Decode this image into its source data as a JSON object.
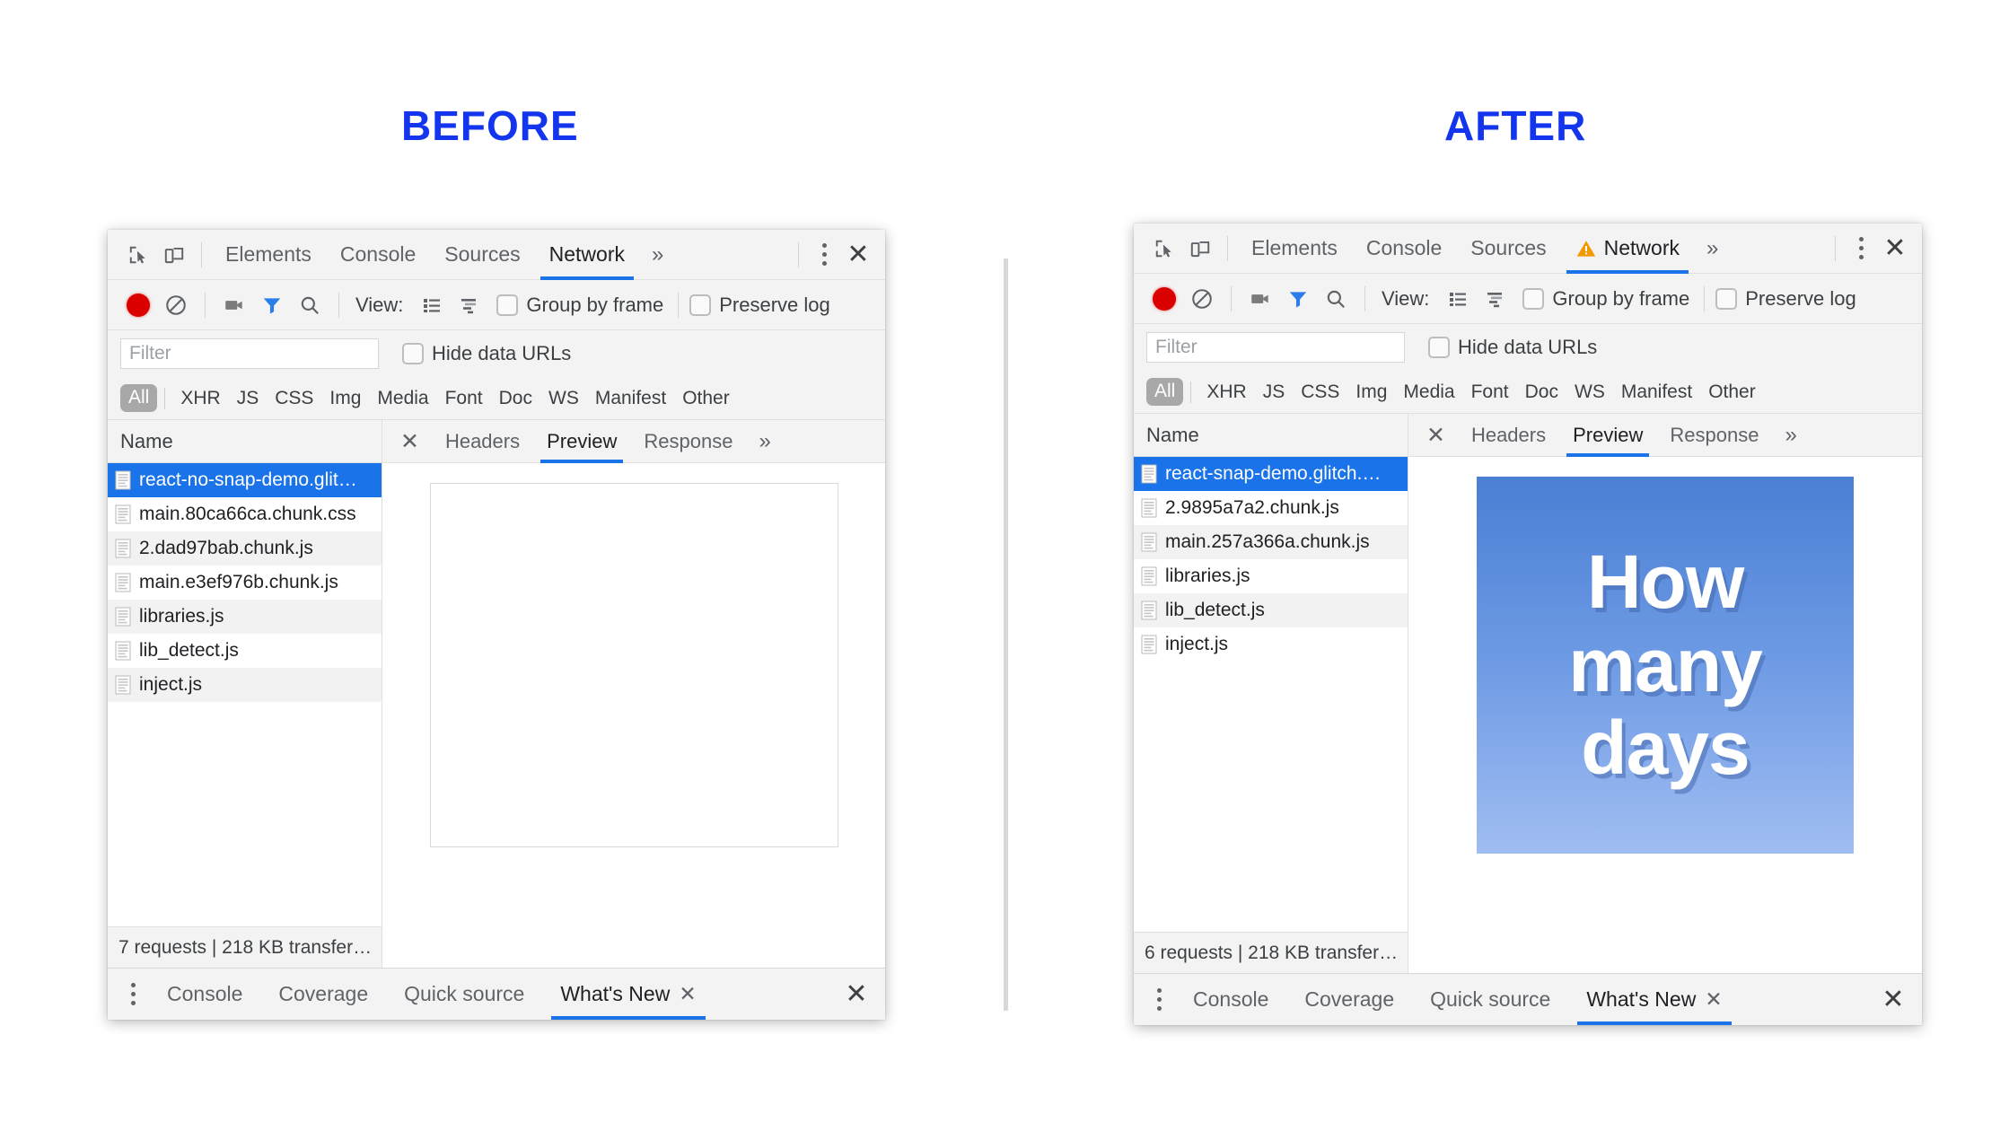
{
  "labels": {
    "before_title": "BEFORE",
    "after_title": "AFTER"
  },
  "colors": {
    "title_blue": "#1435ee",
    "accent_blue": "#1a73e8",
    "selection_blue": "#1a73e8",
    "record_red": "#db0000",
    "warning_orange": "#f29900",
    "toolbar_gray": "#f3f3f3",
    "preview_gradient_top": "#4a7fd4",
    "preview_gradient_bottom": "#a0bdf2"
  },
  "before": {
    "tabs": [
      {
        "label": "Elements",
        "active": false,
        "warning": false
      },
      {
        "label": "Console",
        "active": false,
        "warning": false
      },
      {
        "label": "Sources",
        "active": false,
        "warning": false
      },
      {
        "label": "Network",
        "active": true,
        "warning": false
      }
    ],
    "more_tabs_icon": "»",
    "toolbar": {
      "view_label": "View:",
      "group_by_frame_label": "Group by frame",
      "preserve_log_label": "Preserve log"
    },
    "filter": {
      "placeholder": "Filter",
      "value": "",
      "hide_data_urls_label": "Hide data URLs"
    },
    "types": [
      "All",
      "XHR",
      "JS",
      "CSS",
      "Img",
      "Media",
      "Font",
      "Doc",
      "WS",
      "Manifest",
      "Other"
    ],
    "name_column_header": "Name",
    "files": [
      {
        "name": "react-no-snap-demo.glit…",
        "selected": true
      },
      {
        "name": "main.80ca66ca.chunk.css",
        "selected": false
      },
      {
        "name": "2.dad97bab.chunk.js",
        "selected": false
      },
      {
        "name": "main.e3ef976b.chunk.js",
        "selected": false
      },
      {
        "name": "libraries.js",
        "selected": false
      },
      {
        "name": "lib_detect.js",
        "selected": false
      },
      {
        "name": "inject.js",
        "selected": false
      }
    ],
    "status": "7 requests | 218 KB transfer…",
    "subtabs": [
      {
        "label": "Headers",
        "active": false
      },
      {
        "label": "Preview",
        "active": true
      },
      {
        "label": "Response",
        "active": false
      }
    ],
    "subtabs_more_icon": "»",
    "preview": {
      "kind": "empty",
      "lines": []
    },
    "drawer": {
      "tabs": [
        {
          "label": "Console",
          "active": false,
          "closable": false
        },
        {
          "label": "Coverage",
          "active": false,
          "closable": false
        },
        {
          "label": "Quick source",
          "active": false,
          "closable": false
        },
        {
          "label": "What's New",
          "active": true,
          "closable": true
        }
      ]
    }
  },
  "after": {
    "tabs": [
      {
        "label": "Elements",
        "active": false,
        "warning": false
      },
      {
        "label": "Console",
        "active": false,
        "warning": false
      },
      {
        "label": "Sources",
        "active": false,
        "warning": false
      },
      {
        "label": "Network",
        "active": true,
        "warning": true
      }
    ],
    "more_tabs_icon": "»",
    "toolbar": {
      "view_label": "View:",
      "group_by_frame_label": "Group by frame",
      "preserve_log_label": "Preserve log"
    },
    "filter": {
      "placeholder": "Filter",
      "value": "",
      "hide_data_urls_label": "Hide data URLs"
    },
    "types": [
      "All",
      "XHR",
      "JS",
      "CSS",
      "Img",
      "Media",
      "Font",
      "Doc",
      "WS",
      "Manifest",
      "Other"
    ],
    "name_column_header": "Name",
    "files": [
      {
        "name": "react-snap-demo.glitch.…",
        "selected": true
      },
      {
        "name": "2.9895a7a2.chunk.js",
        "selected": false
      },
      {
        "name": "main.257a366a.chunk.js",
        "selected": false
      },
      {
        "name": "libraries.js",
        "selected": false
      },
      {
        "name": "lib_detect.js",
        "selected": false
      },
      {
        "name": "inject.js",
        "selected": false
      }
    ],
    "status": "6 requests | 218 KB transfer…",
    "subtabs": [
      {
        "label": "Headers",
        "active": false
      },
      {
        "label": "Preview",
        "active": true
      },
      {
        "label": "Response",
        "active": false
      }
    ],
    "subtabs_more_icon": "»",
    "preview": {
      "kind": "image",
      "lines": [
        "How",
        "many",
        "days"
      ]
    },
    "drawer": {
      "tabs": [
        {
          "label": "Console",
          "active": false,
          "closable": false
        },
        {
          "label": "Coverage",
          "active": false,
          "closable": false
        },
        {
          "label": "Quick source",
          "active": false,
          "closable": false
        },
        {
          "label": "What's New",
          "active": true,
          "closable": true
        }
      ]
    }
  }
}
